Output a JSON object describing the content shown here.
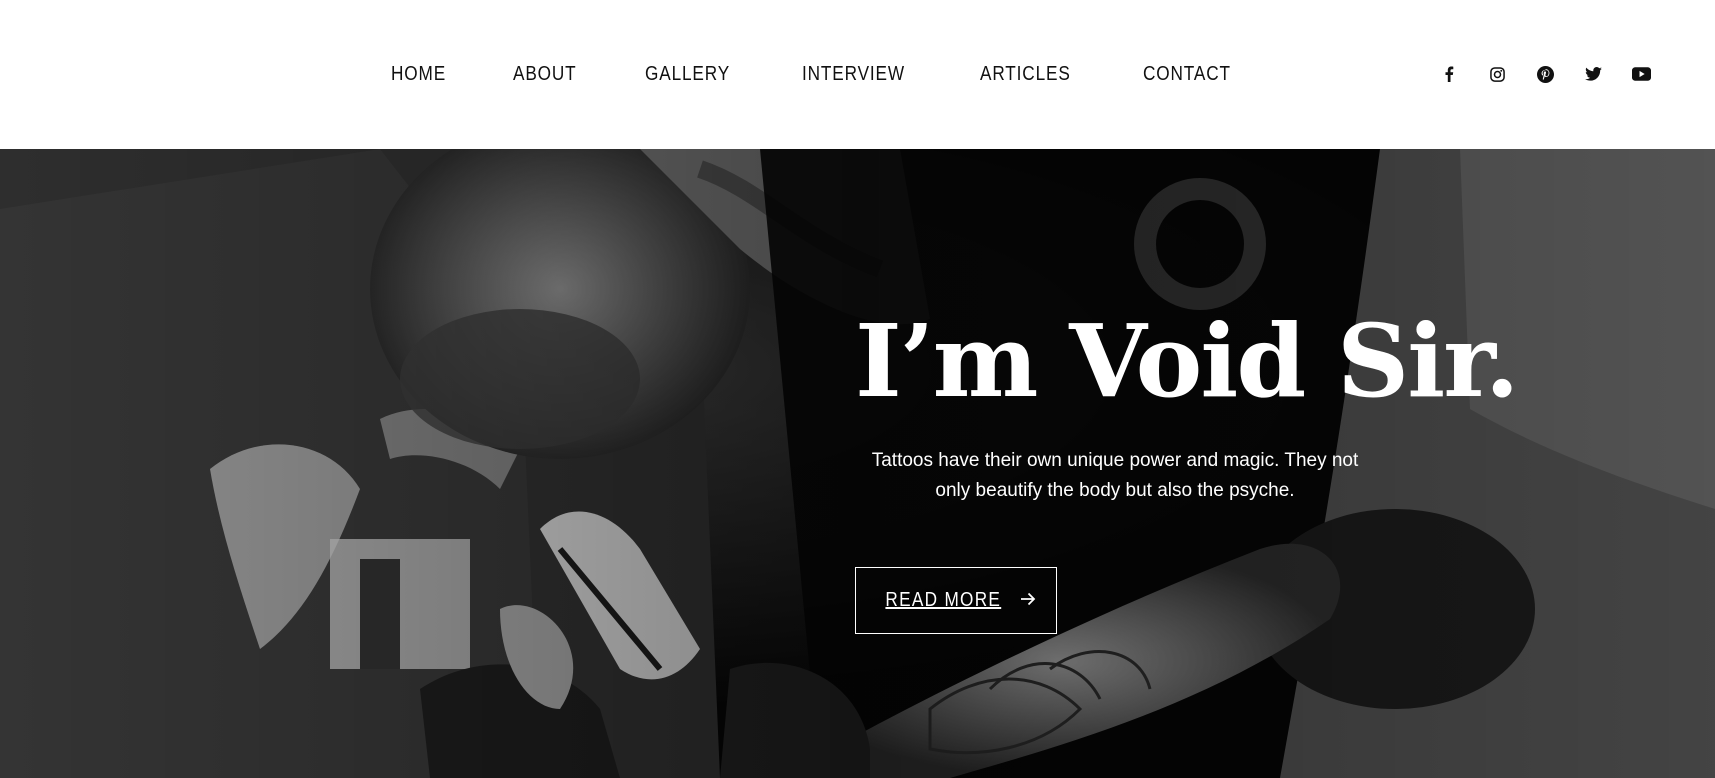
{
  "nav": {
    "items": [
      {
        "label": "HOME"
      },
      {
        "label": "ABOUT"
      },
      {
        "label": "GALLERY"
      },
      {
        "label": "INTERVIEW"
      },
      {
        "label": "ARTICLES"
      },
      {
        "label": "CONTACT"
      }
    ]
  },
  "social": {
    "icons": [
      "facebook-icon",
      "instagram-icon",
      "pinterest-icon",
      "twitter-icon",
      "youtube-icon"
    ]
  },
  "hero": {
    "title": "I’m Void Sir.",
    "text": "Tattoos have their own unique power and magic. They not only beautify the body but also the psyche.",
    "button_label": "READ MORE",
    "button_icon": "arrow-right-icon"
  },
  "colors": {
    "header_bg": "#ffffff",
    "nav_text": "#111111",
    "hero_text": "#ffffff"
  }
}
